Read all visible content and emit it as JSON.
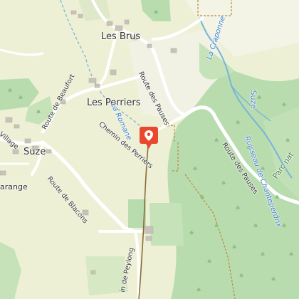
{
  "map": {
    "places": {
      "les_brus": "Les Brus",
      "les_perriers": "Les Perriers",
      "suze": "Suze",
      "garange": "arange",
      "village": "Village",
      "suze_east": "Suze"
    },
    "roads": {
      "route_beaufort": "Route de Beaufort",
      "route_pauses_north": "Route des Pauses",
      "route_pauses_south": "Route des Pauses",
      "chemin_perriers": "Chemin des Perriers",
      "route_blacons": "Route de Blacons",
      "chemin_peylong": "in de Peylong"
    },
    "water": {
      "romane": "La Romane",
      "craponne": "La Craponne",
      "ruisseau": "Ruisseau de Chanteperdrix"
    },
    "park": "Parc nat",
    "marker_icon": "location-pin-icon",
    "colors": {
      "background": "#eef0d6",
      "forest": "#b9dcae",
      "forest_light": "#cde6c2",
      "road": "#ffffff",
      "water": "#77b5d9",
      "marker": "#e8482b",
      "track": "#8a6b3a",
      "boundary": "#b98a3e"
    }
  }
}
